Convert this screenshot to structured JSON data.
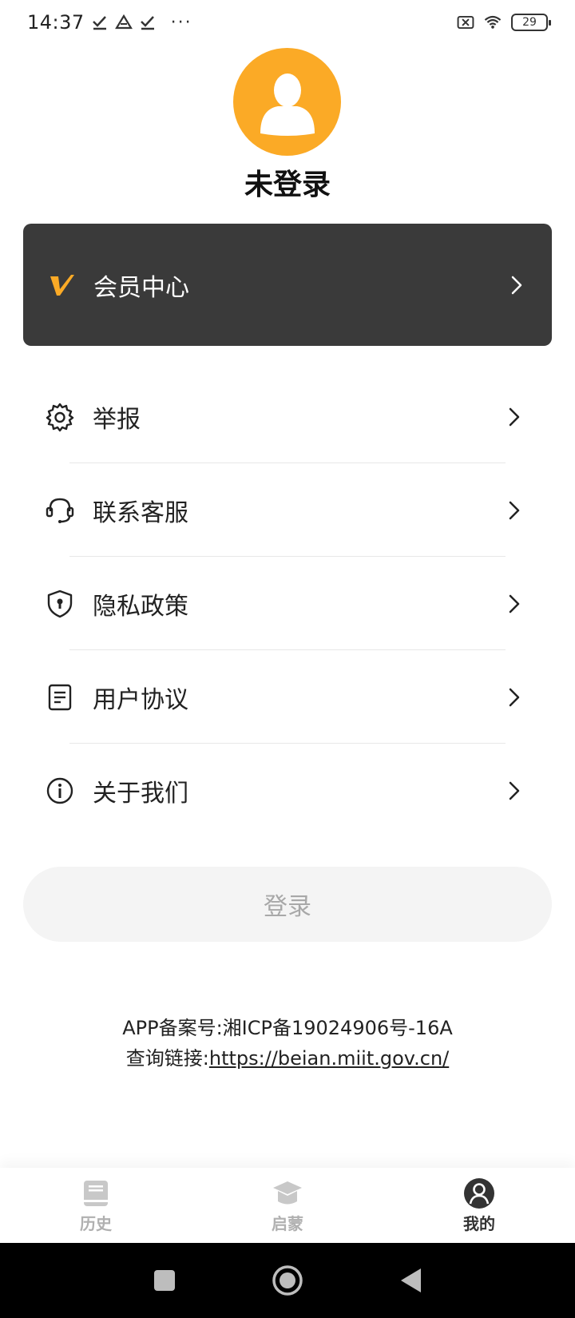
{
  "status_bar": {
    "time": "14:37",
    "dots": "···",
    "battery": "29"
  },
  "profile": {
    "name": "未登录"
  },
  "vip": {
    "label": "会员中心"
  },
  "menu": {
    "items": [
      {
        "label": "举报",
        "icon": "gear-icon"
      },
      {
        "label": "联系客服",
        "icon": "headset-icon"
      },
      {
        "label": "隐私政策",
        "icon": "shield-icon"
      },
      {
        "label": "用户协议",
        "icon": "document-icon"
      },
      {
        "label": "关于我们",
        "icon": "info-icon"
      }
    ]
  },
  "login": {
    "label": "登录"
  },
  "footer": {
    "beian_prefix": "APP备案号:",
    "beian_number": "湘ICP备19024906号-16A",
    "query_prefix": "查询链接:",
    "query_link": "https://beian.miit.gov.cn/"
  },
  "tabs": [
    {
      "label": "历史",
      "icon": "book-icon",
      "active": false
    },
    {
      "label": "启蒙",
      "icon": "graduation-cap-icon",
      "active": false
    },
    {
      "label": "我的",
      "icon": "profile-icon",
      "active": true
    }
  ],
  "colors": {
    "accent": "#FBAA26",
    "vip_bg": "#3a3a3a",
    "login_bg": "#f4f4f4"
  }
}
